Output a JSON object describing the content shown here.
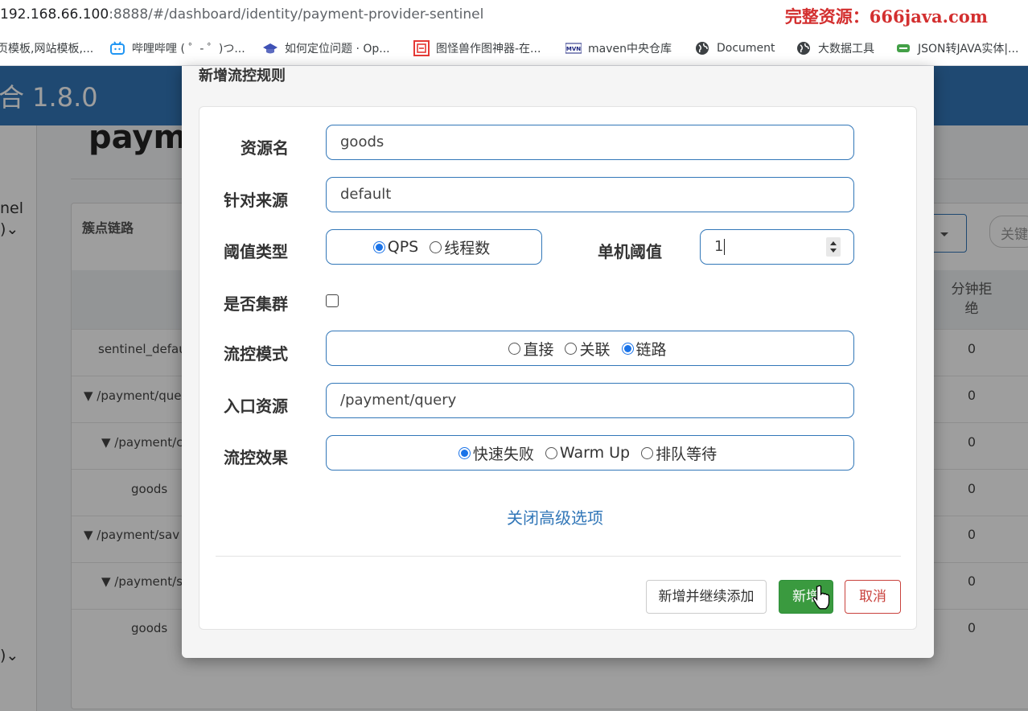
{
  "browser": {
    "url_host": "192.168.66.100",
    "url_rest": ":8888/#/dashboard/identity/payment-provider-sentinel",
    "watermark": "完整资源：666java.com",
    "bookmarks": [
      {
        "label": "页模板,网站模板,..."
      },
      {
        "label": "哔哩哔哩 ( ゜- ゜)つ..."
      },
      {
        "label": "如何定位问题 · Op..."
      },
      {
        "label": "图怪兽作图神器-在..."
      },
      {
        "label": "maven中央仓库"
      },
      {
        "label": "Document"
      },
      {
        "label": "大数据工具"
      },
      {
        "label": "JSON转JAVA实体|..."
      }
    ]
  },
  "app": {
    "version": "合 1.8.0",
    "page_title": "payme",
    "sidebar": {
      "item1": "nel",
      "item1_sub": ")⌄",
      "item2_sub": ")⌄"
    },
    "panel_title": "簇点链路",
    "search_placeholder": "关键",
    "column_head": "分钟拒绝",
    "rows": [
      {
        "name": "sentinel_defau",
        "value": "0"
      },
      {
        "name": "▼ /payment/que",
        "value": "0"
      },
      {
        "name": "▼ /payment/c",
        "value": "0"
      },
      {
        "name": "goods",
        "value": "0"
      },
      {
        "name": "▼ /payment/sav",
        "value": "0"
      },
      {
        "name": "▼ /payment/s",
        "value": "0"
      },
      {
        "name": "goods",
        "value": "0"
      }
    ]
  },
  "modal": {
    "title": "新增流控规则",
    "resource_label": "资源名",
    "resource_value": "goods",
    "origin_label": "针对来源",
    "origin_value": "default",
    "grade_label": "阈值类型",
    "grade_options": [
      "QPS",
      "线程数"
    ],
    "grade_selected": "QPS",
    "threshold_label": "单机阈值",
    "threshold_value": "1",
    "cluster_label": "是否集群",
    "cluster_checked": false,
    "strategy_label": "流控模式",
    "strategy_options": [
      "直接",
      "关联",
      "链路"
    ],
    "strategy_selected": "链路",
    "entry_label": "入口资源",
    "entry_value": "/payment/query",
    "effect_label": "流控效果",
    "effect_options": [
      "快速失败",
      "Warm Up",
      "排队等待"
    ],
    "effect_selected": "快速失败",
    "advanced_link": "关闭高级选项",
    "btn_add_continue": "新增并继续添加",
    "btn_add": "新增",
    "btn_cancel": "取消"
  },
  "colors": {
    "primary": "#3277b8",
    "success": "#3a9a3f",
    "danger": "#c9423d",
    "watermark": "#d32f2f"
  }
}
